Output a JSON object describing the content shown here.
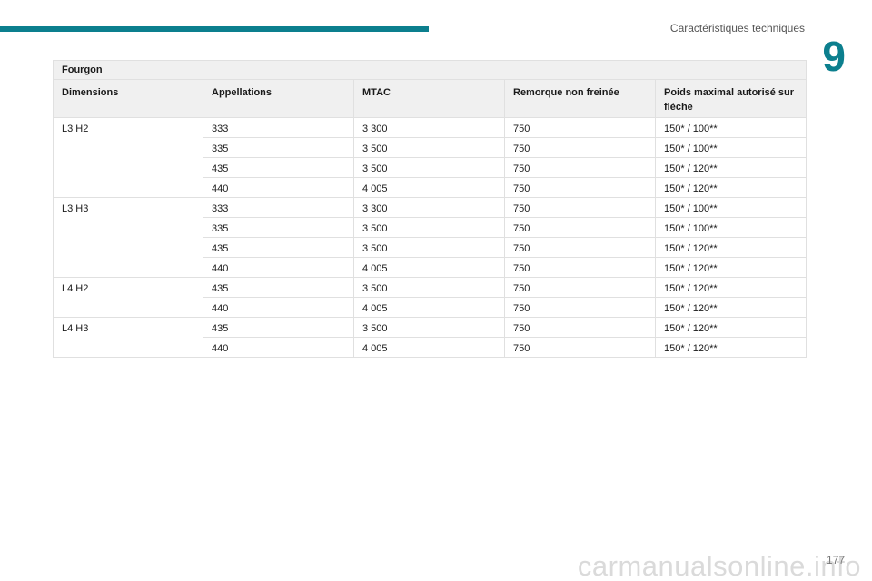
{
  "header": {
    "section_title": "Caractéristiques techniques",
    "chapter_number": "9"
  },
  "table": {
    "caption": "Fourgon",
    "columns": [
      "Dimensions",
      "Appellations",
      "MTAC",
      "Remorque non freinée",
      "Poids maximal autorisé sur flèche"
    ],
    "groups": [
      {
        "dimension": "L3 H2",
        "rows": [
          [
            "333",
            "3 300",
            "750",
            "150* / 100**"
          ],
          [
            "335",
            "3 500",
            "750",
            "150* / 100**"
          ],
          [
            "435",
            "3 500",
            "750",
            "150* / 120**"
          ],
          [
            "440",
            "4 005",
            "750",
            "150* / 120**"
          ]
        ]
      },
      {
        "dimension": "L3 H3",
        "rows": [
          [
            "333",
            "3 300",
            "750",
            "150* / 100**"
          ],
          [
            "335",
            "3 500",
            "750",
            "150* / 100**"
          ],
          [
            "435",
            "3 500",
            "750",
            "150* / 120**"
          ],
          [
            "440",
            "4 005",
            "750",
            "150* / 120**"
          ]
        ]
      },
      {
        "dimension": "L4 H2",
        "rows": [
          [
            "435",
            "3 500",
            "750",
            "150* / 120**"
          ],
          [
            "440",
            "4 005",
            "750",
            "150* / 120**"
          ]
        ]
      },
      {
        "dimension": "L4 H3",
        "rows": [
          [
            "435",
            "3 500",
            "750",
            "150* / 120**"
          ],
          [
            "440",
            "4 005",
            "750",
            "150* / 120**"
          ]
        ]
      }
    ]
  },
  "footer": {
    "page_number": "177",
    "watermark": "carmanualsonline.info"
  },
  "colors": {
    "accent": "#0c7f8e",
    "header_bg": "#f0f0f0",
    "border": "#e0e0e0"
  }
}
